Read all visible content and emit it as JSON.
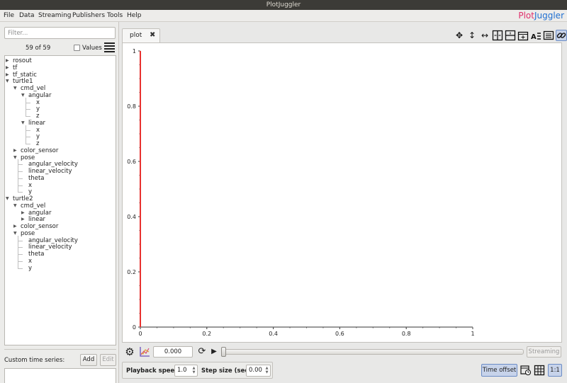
{
  "window": {
    "title": "PlotJuggler"
  },
  "menu": [
    "File",
    "Data",
    "Streaming",
    "Publishers",
    "Tools",
    "Help"
  ],
  "logo": {
    "part1": "Plot",
    "part2": "Juggler",
    "color1": "#e02f6b",
    "color2": "#1f6fd1"
  },
  "sidebar": {
    "filter_placeholder": "Filter...",
    "count": "59 of 59",
    "values_label": "Values",
    "values_checked": false,
    "tree": [
      {
        "label": "rosout",
        "depth": 0,
        "toggle": "collapsed"
      },
      {
        "label": "tf",
        "depth": 0,
        "toggle": "collapsed"
      },
      {
        "label": "tf_static",
        "depth": 0,
        "toggle": "collapsed"
      },
      {
        "label": "turtle1",
        "depth": 0,
        "toggle": "expanded"
      },
      {
        "label": "cmd_vel",
        "depth": 1,
        "toggle": "expanded"
      },
      {
        "label": "angular",
        "depth": 2,
        "toggle": "expanded"
      },
      {
        "label": "x",
        "depth": 3,
        "toggle": "leaf"
      },
      {
        "label": "y",
        "depth": 3,
        "toggle": "leaf"
      },
      {
        "label": "z",
        "depth": 3,
        "toggle": "leaf"
      },
      {
        "label": "linear",
        "depth": 2,
        "toggle": "expanded"
      },
      {
        "label": "x",
        "depth": 3,
        "toggle": "leaf"
      },
      {
        "label": "y",
        "depth": 3,
        "toggle": "leaf"
      },
      {
        "label": "z",
        "depth": 3,
        "toggle": "leaf"
      },
      {
        "label": "color_sensor",
        "depth": 1,
        "toggle": "collapsed"
      },
      {
        "label": "pose",
        "depth": 1,
        "toggle": "expanded"
      },
      {
        "label": "angular_velocity",
        "depth": 2,
        "toggle": "leaf"
      },
      {
        "label": "linear_velocity",
        "depth": 2,
        "toggle": "leaf"
      },
      {
        "label": "theta",
        "depth": 2,
        "toggle": "leaf"
      },
      {
        "label": "x",
        "depth": 2,
        "toggle": "leaf"
      },
      {
        "label": "y",
        "depth": 2,
        "toggle": "leaf"
      },
      {
        "label": "turtle2",
        "depth": 0,
        "toggle": "expanded"
      },
      {
        "label": "cmd_vel",
        "depth": 1,
        "toggle": "expanded"
      },
      {
        "label": "angular",
        "depth": 2,
        "toggle": "collapsed"
      },
      {
        "label": "linear",
        "depth": 2,
        "toggle": "collapsed"
      },
      {
        "label": "color_sensor",
        "depth": 1,
        "toggle": "collapsed"
      },
      {
        "label": "pose",
        "depth": 1,
        "toggle": "expanded"
      },
      {
        "label": "angular_velocity",
        "depth": 2,
        "toggle": "leaf"
      },
      {
        "label": "linear_velocity",
        "depth": 2,
        "toggle": "leaf"
      },
      {
        "label": "theta",
        "depth": 2,
        "toggle": "leaf"
      },
      {
        "label": "x",
        "depth": 2,
        "toggle": "leaf"
      },
      {
        "label": "y",
        "depth": 2,
        "toggle": "leaf"
      }
    ],
    "custom_series_label": "Custom time series:",
    "add_label": "Add",
    "edit_label": "Edit"
  },
  "tabs": [
    {
      "label": "plot",
      "close": "✖"
    }
  ],
  "toolbar_icons": [
    "move-icon",
    "zoom-vertical-icon",
    "zoom-horizontal-icon",
    "split-horizontal-icon",
    "split-vertical-icon",
    "add-tab-icon",
    "legend-icon",
    "grid-list-icon",
    "link-icon"
  ],
  "chart_data": {
    "type": "line",
    "x": [
      0,
      0
    ],
    "y": [
      0,
      1
    ],
    "series": [
      {
        "values": [
          0,
          1
        ],
        "color": "#e8322f"
      }
    ],
    "xlim": [
      0,
      1
    ],
    "ylim": [
      0,
      1
    ],
    "xticks": [
      "0",
      "0.2",
      "0.4",
      "0.6",
      "0.8",
      "1"
    ],
    "yticks": [
      "0",
      "0.2",
      "0.4",
      "0.6",
      "0.8",
      "1"
    ],
    "grid": false
  },
  "playback": {
    "time_value": "0.000",
    "slider_position": 0,
    "streaming_label": "Streaming",
    "speed_label": "Playback speed:",
    "speed_value": "1.0",
    "step_label": "Step size (sec):",
    "step_value": "0.00",
    "time_offset_label": "Time offset",
    "ratio_label": "1:1"
  },
  "colors": {
    "accent": "#c7d3ea",
    "accent_border": "#6b8cc6",
    "curve": "#e8322f"
  }
}
